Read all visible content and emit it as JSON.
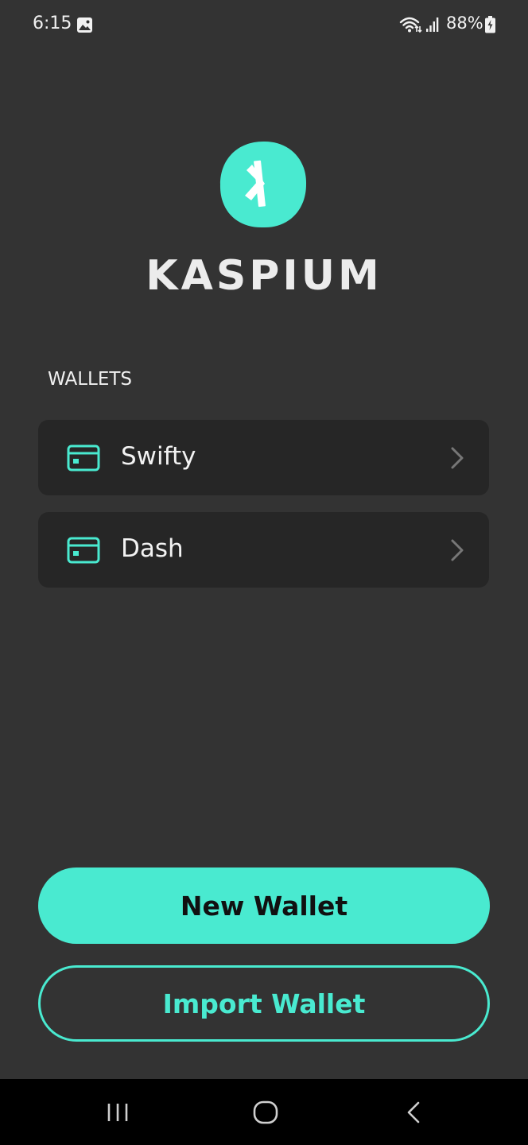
{
  "status_bar": {
    "time": "6:15",
    "battery": "88%",
    "icons": [
      "gallery-icon",
      "wifi-icon",
      "signal-icon",
      "battery-icon"
    ]
  },
  "app": {
    "name": "KASPIUM",
    "logo_letter": "K"
  },
  "wallets": {
    "heading": "WALLETS",
    "items": [
      {
        "name": "Swifty",
        "icon": "wallet-card-icon"
      },
      {
        "name": "Dash",
        "icon": "wallet-card-icon"
      }
    ]
  },
  "actions": {
    "new_wallet": "New Wallet",
    "import_wallet": "Import Wallet"
  },
  "nav": {
    "buttons": [
      "recents",
      "home",
      "back"
    ]
  },
  "colors": {
    "background": "#333333",
    "card": "#262626",
    "accent": "#49ead0",
    "text": "#f2f2f2",
    "nav_bar": "#000000"
  }
}
